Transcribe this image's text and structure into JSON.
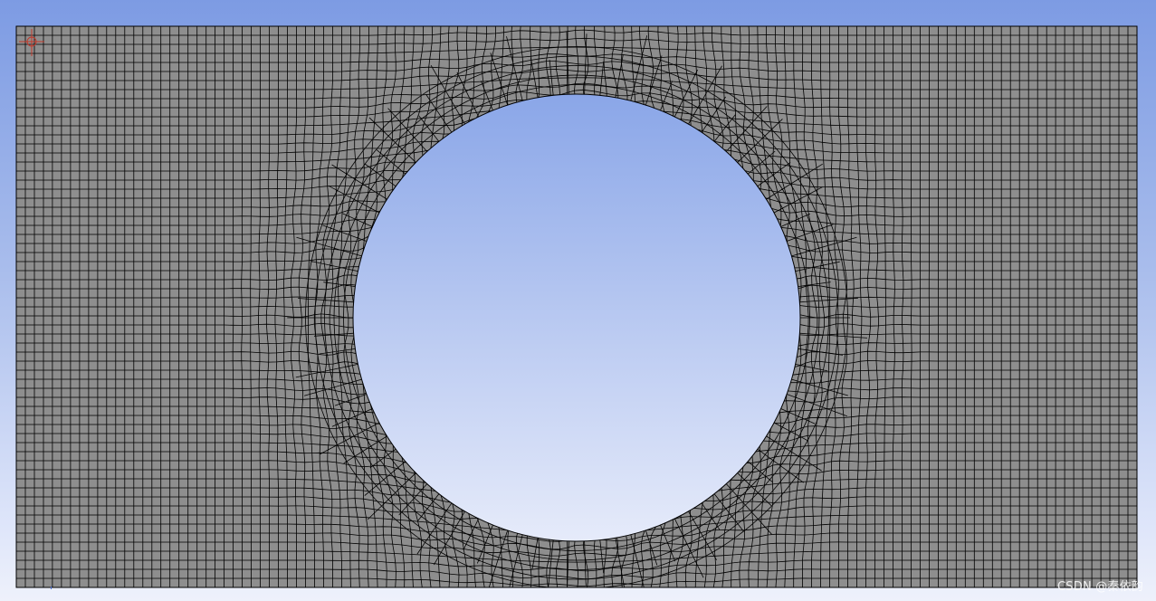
{
  "viewport": {
    "mesh_fill": "#8e8e8e",
    "mesh_line": "#000000",
    "hole_gradient_top": "#8aa6e8",
    "hole_gradient_bottom": "#e6ebfa",
    "origin_marker_color": "#c0392b"
  },
  "icons": {
    "origin": "coordinate-origin-icon"
  },
  "watermark": {
    "text": "CSDN @秦依韵"
  }
}
